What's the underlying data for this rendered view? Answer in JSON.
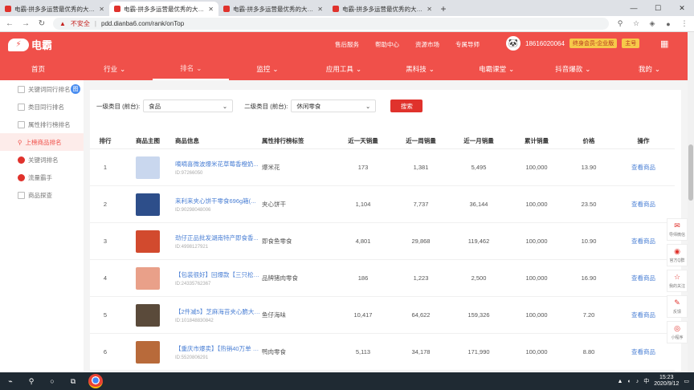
{
  "browser": {
    "tabs": [
      {
        "title": "电霸-拼多多运营最优秀的大数据"
      },
      {
        "title": "电霸-拼多多运营最优秀的大数据"
      },
      {
        "title": "电霸-拼多多运营最优秀的大数据"
      },
      {
        "title": "电霸-拼多多运营最优秀的大数据"
      }
    ],
    "new_tab": "+",
    "address": {
      "security": "不安全",
      "url": "pdd.dianba6.com/rank/onTop"
    }
  },
  "header": {
    "logo_text": "电霸",
    "links": [
      "售后服务",
      "帮助中心",
      "资源市场",
      "专属导师"
    ],
    "user": {
      "phone": "18616020064",
      "badge": "终身会员-企业版",
      "role": "主号"
    }
  },
  "mainnav": [
    {
      "label": "首页",
      "has_arrow": false
    },
    {
      "label": "行业",
      "has_arrow": true
    },
    {
      "label": "排名",
      "has_arrow": true
    },
    {
      "label": "监控",
      "has_arrow": true
    },
    {
      "label": "应用工具",
      "has_arrow": true
    },
    {
      "label": "黑科技",
      "has_arrow": true
    },
    {
      "label": "电霸课堂",
      "has_arrow": true
    },
    {
      "label": "抖音爆款",
      "has_arrow": true
    },
    {
      "label": "我的",
      "has_arrow": true
    }
  ],
  "sidebar": {
    "items": [
      {
        "label": "关键词同行排名"
      },
      {
        "label": "类目同行排名"
      },
      {
        "label": "属性排行榜排名"
      },
      {
        "label": "上榜商品排名"
      },
      {
        "label": "关键词排名"
      },
      {
        "label": "流量霸手"
      },
      {
        "label": "商品探查"
      }
    ],
    "badge": "图"
  },
  "filter": {
    "cat1_label": "一级类目 (前台):",
    "cat1_value": "食品",
    "cat2_label": "二级类目 (前台):",
    "cat2_value": "休闲零食",
    "search_label": "搜索"
  },
  "table": {
    "headers": [
      "排行",
      "商品主图",
      "商品信息",
      "属性排行榜标签",
      "近一天销量",
      "近一周销量",
      "近一月销量",
      "累计销量",
      "价格",
      "操作"
    ],
    "rows": [
      {
        "rank": "1",
        "name": "嘀嘀喜微波爆米花草莓香橙奶...",
        "id": "ID:97266050",
        "tag": "爆米花",
        "day": "173",
        "week": "1,381",
        "month": "5,495",
        "total": "100,000",
        "price": "13.90",
        "action": "查看商品"
      },
      {
        "rank": "2",
        "name": "来利来夹心饼干零食696g箱(...",
        "id": "ID:90298048006",
        "tag": "夹心饼干",
        "day": "1,104",
        "week": "7,737",
        "month": "36,144",
        "total": "100,000",
        "price": "23.50",
        "action": "查看商品"
      },
      {
        "rank": "3",
        "name": "劲仔正品批发湖南特产即食香...",
        "id": "ID:4998127921",
        "tag": "即食鱼零食",
        "day": "4,801",
        "week": "29,868",
        "month": "119,462",
        "total": "100,000",
        "price": "10.90",
        "action": "查看商品"
      },
      {
        "rank": "4",
        "name": "【包装很好】回爆款【三只松鼠...",
        "id": "ID:24335762367",
        "tag": "品牌猪肉零食",
        "day": "186",
        "week": "1,223",
        "month": "2,500",
        "total": "100,000",
        "price": "16.90",
        "action": "查看商品"
      },
      {
        "rank": "5",
        "name": "【2件减5】芝麻海苔夹心脆大片...",
        "id": "ID:101848830842",
        "tag": "鱼仔海味",
        "day": "10,417",
        "week": "64,622",
        "month": "159,326",
        "total": "100,000",
        "price": "7.20",
        "action": "查看商品"
      },
      {
        "rank": "6",
        "name": "【重庆市爆卖】【热销40万单 爆...",
        "id": "ID:5520806291",
        "tag": "鸭肉零食",
        "day": "5,113",
        "week": "34,178",
        "month": "171,990",
        "total": "100,000",
        "price": "8.80",
        "action": "查看商品"
      }
    ]
  },
  "floatbar": [
    {
      "label": "导师微信",
      "icon": "wechat-icon"
    },
    {
      "label": "官方Q群",
      "icon": "qq-icon"
    },
    {
      "label": "我的关注",
      "icon": "star-icon"
    },
    {
      "label": "反馈",
      "icon": "edit-icon"
    },
    {
      "label": "小程序",
      "icon": "miniapp-icon"
    }
  ],
  "taskbar": {
    "time": "15:23",
    "date": "2020/9/12",
    "ime": "中"
  }
}
